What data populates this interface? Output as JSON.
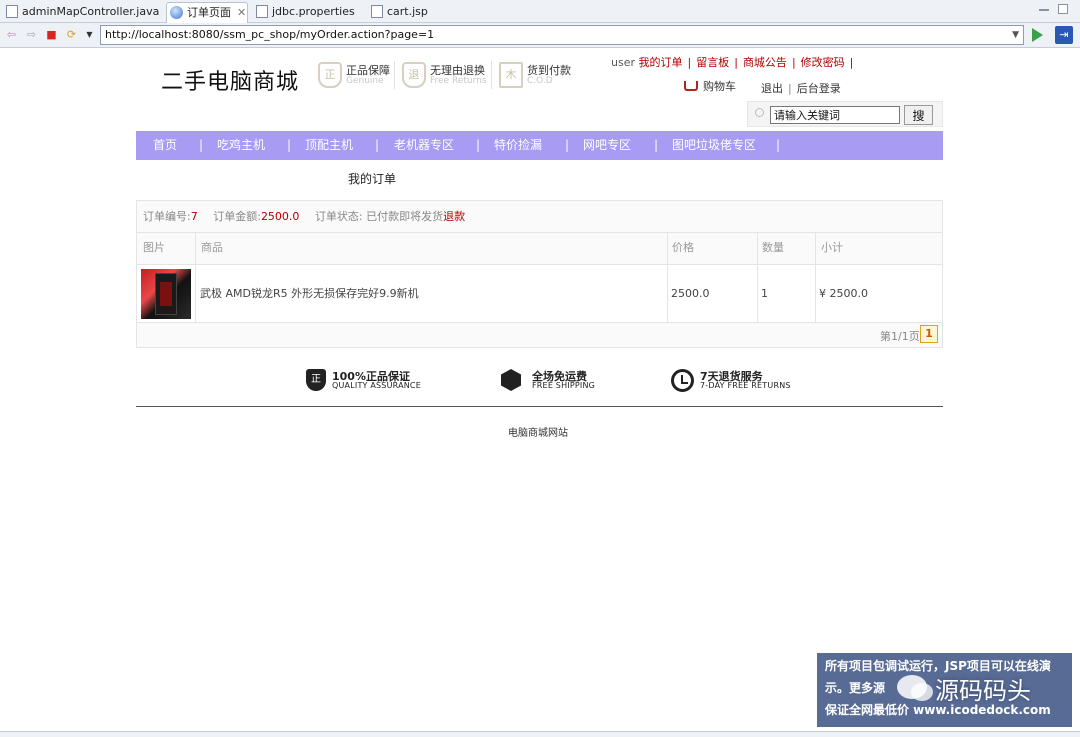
{
  "tabs": [
    {
      "label": "adminMapController.java",
      "active": false
    },
    {
      "label": "订单页面",
      "active": true
    },
    {
      "label": "jdbc.properties",
      "active": false
    },
    {
      "label": "cart.jsp",
      "active": false
    }
  ],
  "browser": {
    "url": "http://localhost:8080/ssm_pc_shop/myOrder.action?page=1"
  },
  "site": {
    "logo": "二手电脑商城",
    "badges": [
      {
        "title": "正品保障",
        "sub": "Genuine",
        "icon": "正"
      },
      {
        "title": "无理由退换",
        "sub": "Free Returns",
        "icon": "退"
      },
      {
        "title": "货到付款",
        "sub": "C.O.D",
        "icon": "木"
      }
    ],
    "user": "user",
    "top_links": [
      "我的订单",
      "留言板",
      "商城公告",
      "修改密码"
    ],
    "cart": "购物车",
    "logout": "退出",
    "admin": "后台登录",
    "search": {
      "value": "请输入关键词",
      "button": "搜"
    }
  },
  "nav": [
    "首页",
    "吃鸡主机",
    "顶配主机",
    "老机器专区",
    "特价捡漏",
    "网吧专区",
    "图吧垃圾佬专区"
  ],
  "page_title": "我的订单",
  "order": {
    "id_label": "订单编号:",
    "id": "7",
    "amount_label": "订单金额:",
    "amount": "2500.0",
    "status_label": "订单状态:",
    "status": "已付款即将发货",
    "refund": "退款",
    "columns": [
      "图片",
      "商品",
      "价格",
      "数量",
      "小计"
    ],
    "items": [
      {
        "name": "武极 AMD锐龙R5 外形无损保存完好9.9新机",
        "price": "2500.0",
        "qty": "1",
        "subtotal": "¥ 2500.0"
      }
    ],
    "pager_text": "第1/1页",
    "page": "1"
  },
  "guarantees": [
    {
      "title": "100%正品保证",
      "sub": "QUALITY ASSURANCE",
      "icon": "正"
    },
    {
      "title": "全场免运费",
      "sub": "FREE SHIPPING",
      "icon": ""
    },
    {
      "title": "7天退货服务",
      "sub": "7-DAY FREE RETURNS",
      "icon": ""
    }
  ],
  "footer": "电脑商城网站",
  "watermark": {
    "line1": "所有项目包调试运行，JSP项目可以在线演",
    "line2": "示。更多源",
    "brand": "源码码头",
    "line3": "保证全网最低价 www.icodedock.com"
  }
}
